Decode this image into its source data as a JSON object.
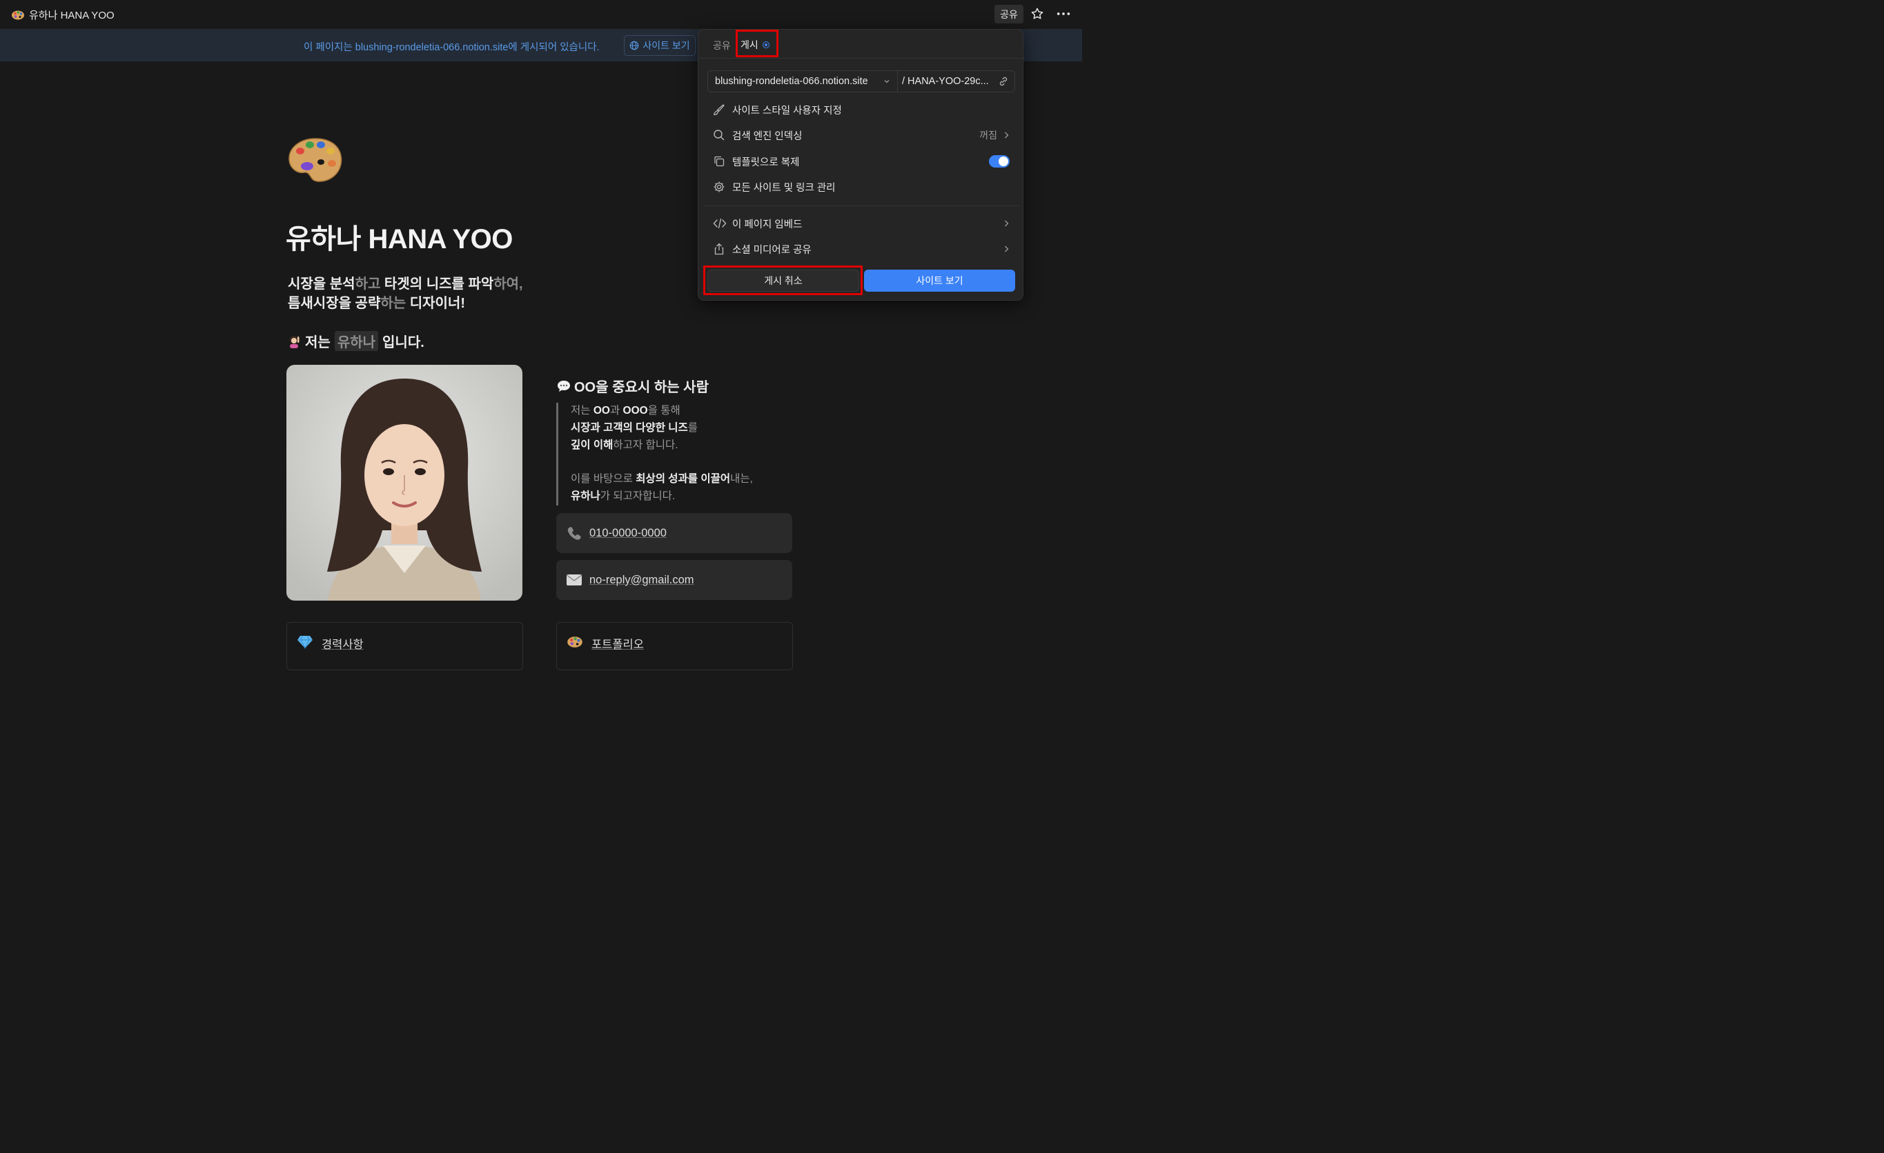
{
  "topbar": {
    "title": "유하나 HANA YOO",
    "share_label": "공유"
  },
  "banner": {
    "text": "이 페이지는 blushing-rondeletia-066.notion.site에 게시되어 있습니다.",
    "button_label": "사이트 보기"
  },
  "page": {
    "title": "유하나 HANA YOO",
    "subtitle_line1": [
      {
        "t": "시장을 분석",
        "dim": false
      },
      {
        "t": "하고",
        "dim": true
      },
      {
        "t": " 타겟의 니즈를 파악",
        "dim": false
      },
      {
        "t": "하여,",
        "dim": true
      }
    ],
    "subtitle_line2": [
      {
        "t": "틈새시장을 공략",
        "dim": false
      },
      {
        "t": "하는",
        "dim": true
      },
      {
        "t": " 디자이너!",
        "dim": false
      }
    ],
    "intro_prefix": "저는",
    "intro_name": "유하나",
    "intro_suffix": "입니다.",
    "right_heading": "OO을 중요시 하는 사람",
    "quote": {
      "l1_a": "저는 ",
      "l1_b": "OO",
      "l1_c": "과 ",
      "l1_d": "OOO",
      "l1_e": "을 통해",
      "l2_a": "시장과 고객의 다양한 니즈",
      "l2_b": "를",
      "l3_a": "깊이 이해",
      "l3_b": "하고자 합니다.",
      "l4_a": "이를 바탕으로 ",
      "l4_b": "최상의 성과를 이끌어",
      "l4_c": "내는,",
      "l5_a": "유하나",
      "l5_b": "가 되고자합니다."
    },
    "phone": "010-0000-0000",
    "email": "no-reply@gmail.com",
    "career_label": "경력사항",
    "portfolio_label": "포트폴리오"
  },
  "publish_panel": {
    "tab_share": "공유",
    "tab_publish": "게시",
    "domain": "blushing-rondeletia-066.notion.site",
    "slug": "/ HANA-YOO-29c...",
    "customize_site_style": "사이트 스타일 사용자 지정",
    "search_engine_indexing": "검색 엔진 인덱싱",
    "search_engine_value": "꺼짐",
    "duplicate_as_template": "템플릿으로 복제",
    "duplicate_as_template_on": true,
    "manage_sites_links": "모든 사이트 및 링크 관리",
    "embed_page": "이 페이지 임베드",
    "share_social": "소셜 미디어로 공유",
    "unpublish_label": "게시 취소",
    "view_site_label": "사이트 보기",
    "accent_color": "#3b82f6",
    "highlight_color": "#e00000"
  }
}
